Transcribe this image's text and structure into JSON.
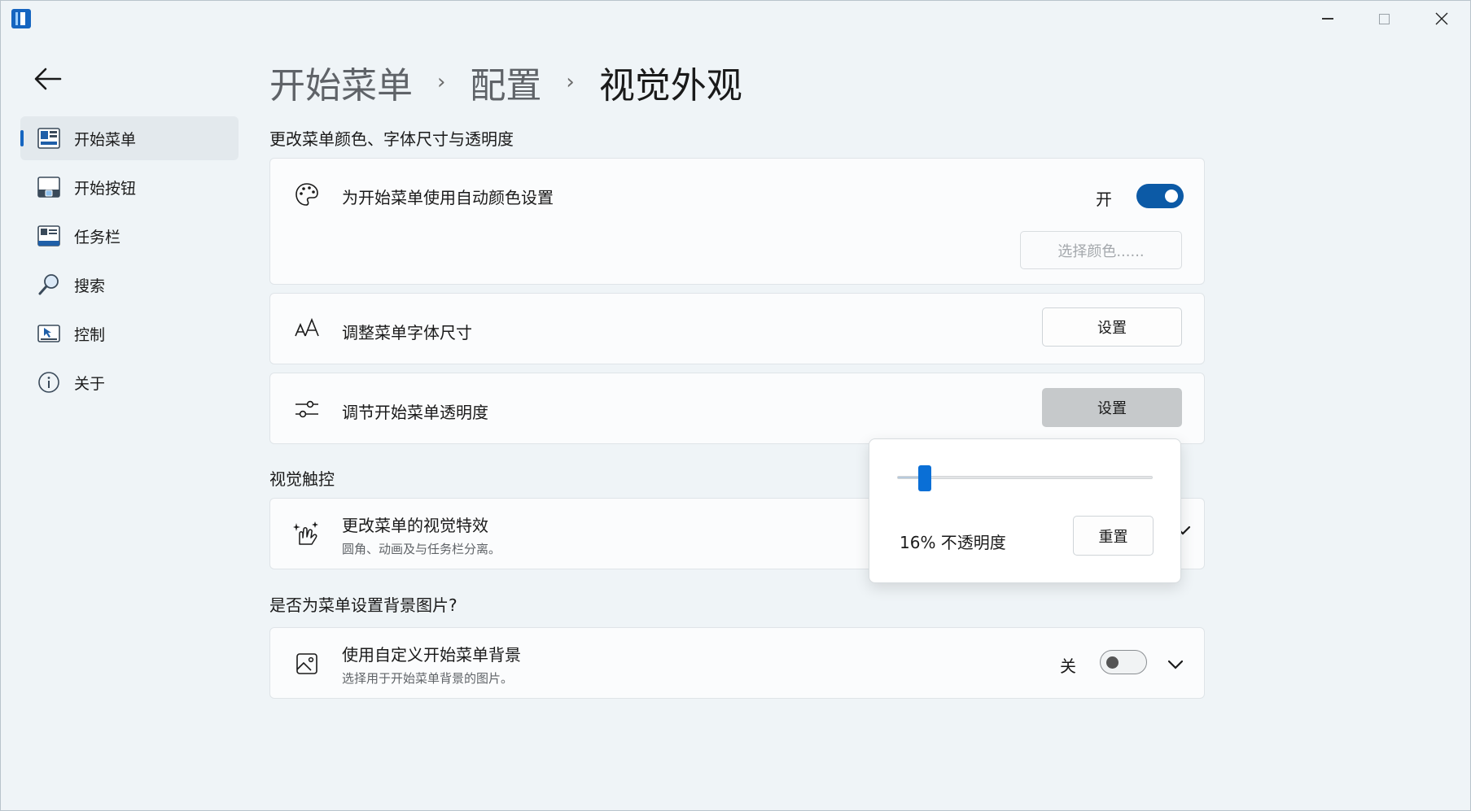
{
  "window": {
    "minimize_icon": "minimize-icon",
    "maximize_icon": "maximize-icon",
    "close_icon": "close-icon"
  },
  "sidebar": {
    "items": [
      {
        "label": "开始菜单",
        "icon": "start-menu-icon",
        "active": true
      },
      {
        "label": "开始按钮",
        "icon": "start-button-icon",
        "active": false
      },
      {
        "label": "任务栏",
        "icon": "taskbar-icon",
        "active": false
      },
      {
        "label": "搜索",
        "icon": "search-icon",
        "active": false
      },
      {
        "label": "控制",
        "icon": "control-icon",
        "active": false
      },
      {
        "label": "关于",
        "icon": "info-icon",
        "active": false
      }
    ]
  },
  "breadcrumb": {
    "items": [
      "开始菜单",
      "配置",
      "视觉外观"
    ],
    "separator": "›"
  },
  "sections": {
    "colors_title": "更改菜单颜色、字体尺寸与透明度",
    "visual_title": "视觉触控",
    "background_title": "是否为菜单设置背景图片?"
  },
  "cards": {
    "auto_color": {
      "title": "为开始菜单使用自动颜色设置",
      "toggle_label": "开",
      "toggle_on": true,
      "button": "选择颜色......"
    },
    "font_size": {
      "title": "调整菜单字体尺寸",
      "button": "设置"
    },
    "transparency": {
      "title": "调节开始菜单透明度",
      "button": "设置"
    },
    "visual_effects": {
      "title": "更改菜单的视觉特效",
      "subtitle": "圆角、动画及与任务栏分离。"
    },
    "background": {
      "title": "使用自定义开始菜单背景",
      "subtitle": "选择用于开始菜单背景的图片。",
      "toggle_label": "关",
      "toggle_on": false
    }
  },
  "flyout": {
    "opacity_percent": 16,
    "opacity_text": "16% 不透明度",
    "reset_button": "重置"
  },
  "colors": {
    "accent": "#0c5aa6",
    "slider_thumb": "#0a6fd6"
  }
}
